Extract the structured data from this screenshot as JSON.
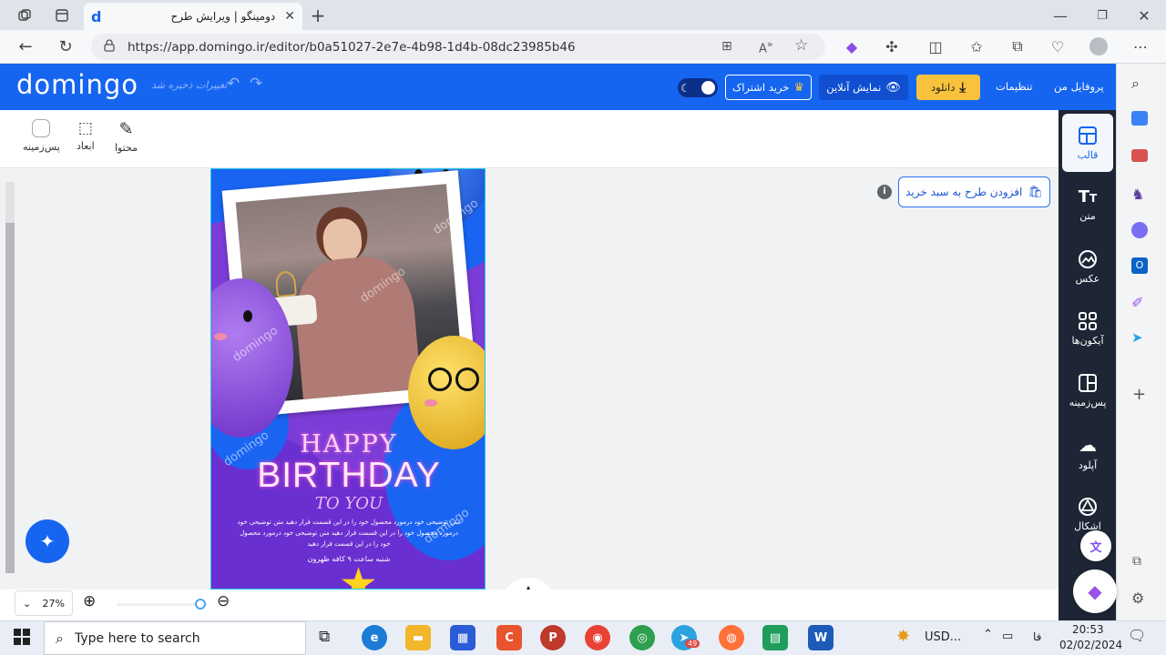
{
  "browser": {
    "tab_title": "دومینگو | ویرایش طرح",
    "tab_favicon": "d",
    "url": "https://app.domingo.ir/editor/b0a51027-2e7e-4b98-1d4b-08dc23985b46"
  },
  "header": {
    "logo": "domingo",
    "save_status": "تغییرات ذخیره شد",
    "profile": "پروفایل من",
    "settings": "تنظیمات",
    "download": "دانلود",
    "preview": "نمایش آنلاین",
    "subscribe": "خرید اشتراک"
  },
  "toolbar": {
    "content": "محتوا",
    "dimensions": "ابعاد",
    "background": "پس‌زمینه"
  },
  "rail": [
    {
      "label": "قالب",
      "icon": "template-icon"
    },
    {
      "label": "متن",
      "icon": "text-icon"
    },
    {
      "label": "عکس",
      "icon": "image-icon"
    },
    {
      "label": "آیکون‌ها",
      "icon": "grid-icon"
    },
    {
      "label": "پس‌زمینه",
      "icon": "background-icon"
    },
    {
      "label": "آپلود",
      "icon": "upload-icon"
    },
    {
      "label": "اشکال",
      "icon": "shapes-icon"
    }
  ],
  "cart_button": "افزودن طرح به سبد خرید",
  "zoom": "27%",
  "design": {
    "happy": "HAPPY",
    "birthday": "BIRTHDAY",
    "to_you": "TO YOU",
    "desc1": "متن توضیحی خود درمورد محصول خود را در این قسمت قرار دهید متن توضیحی خود",
    "desc2": "درمورد محصول خود را در این قسمت قرار دهید متن توضیحی خود درمورد محصول",
    "desc3": "خود را در این قسمت قرار دهید",
    "time": "شنبه ساعت ۹ کافه طهرون",
    "watermark": "domingo"
  },
  "taskbar": {
    "search_placeholder": "Type here to search",
    "currency": "USD...",
    "lang": "فا",
    "time": "20:53",
    "date": "02/02/2024",
    "telegram_badge": "49"
  },
  "colors": {
    "header_blue": "#1565f0",
    "rail_dark": "#1e2535",
    "download_yellow": "#f9c23c",
    "design_purple": "#7c3cd8",
    "design_blue": "#1a64f2"
  }
}
